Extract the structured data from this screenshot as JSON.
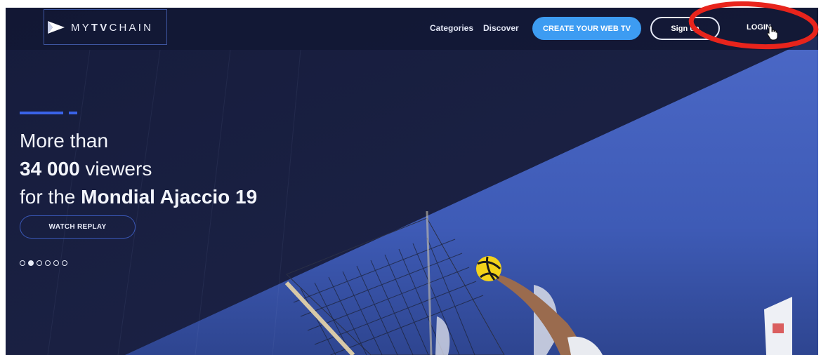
{
  "logo": {
    "text_light": "MY",
    "text_bold": "TV",
    "text_end": "CHAIN"
  },
  "nav": {
    "categories": "Categories",
    "discover": "Discover",
    "create_web_tv": "CREATE YOUR WEB TV",
    "sign_up": "Sign up",
    "login": "LOGIN"
  },
  "hero": {
    "line1": "More than",
    "line2_bold": "34 000",
    "line2_rest": " viewers",
    "line3_pre": "for the ",
    "line3_bold": "Mondial Ajaccio 19",
    "cta": "WATCH REPLAY",
    "slides_total": 6,
    "active_slide": 2
  },
  "colors": {
    "accent_blue": "#3d9cf2",
    "hero_dark": "#141a3a",
    "indicator_blue": "#3a63e8",
    "annotation_red": "#e8241c"
  },
  "icons": {
    "logo_mark": "play-triangle-icon",
    "cursor": "hand-pointer-icon"
  }
}
